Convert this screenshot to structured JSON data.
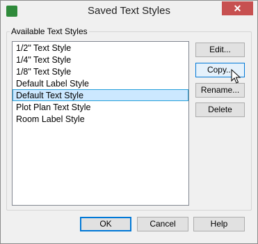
{
  "window": {
    "title": "Saved Text Styles",
    "close_glyph": "✕"
  },
  "group": {
    "label": "Available Text Styles"
  },
  "list": {
    "items": [
      "1/2\" Text Style",
      "1/4\" Text Style",
      "1/8\" Text Style",
      "Default Label Style",
      "Default Text Style",
      "Plot Plan Text Style",
      "Room Label Style"
    ],
    "selected": "Default Text Style"
  },
  "side_buttons": {
    "edit": "Edit...",
    "copy": "Copy...",
    "rename": "Rename...",
    "delete": "Delete"
  },
  "bottom_buttons": {
    "ok": "OK",
    "cancel": "Cancel",
    "help": "Help"
  },
  "icons": {
    "app": "app-icon",
    "close": "close-icon",
    "cursor": "mouse-pointer-icon"
  },
  "colors": {
    "close_bg": "#c75050",
    "selection_bg": "#cce8ff",
    "selection_border": "#26a0da",
    "focus_border": "#0078d7"
  }
}
